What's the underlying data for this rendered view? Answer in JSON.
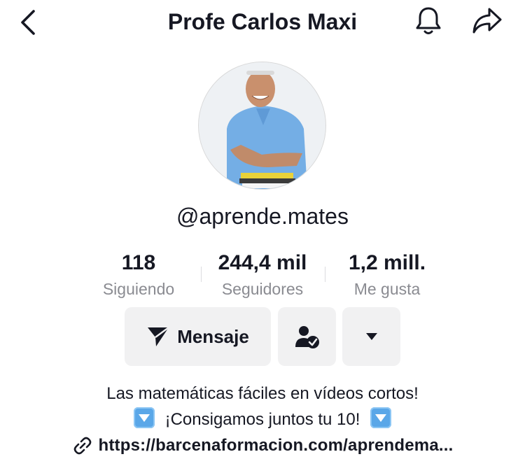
{
  "header": {
    "title": "Profe Carlos Maxi",
    "back_icon": "chevron-left-icon",
    "bell_icon": "bell-icon",
    "share_icon": "share-arrow-icon"
  },
  "profile": {
    "username": "@aprende.mates",
    "avatar_icon": "profile-photo"
  },
  "stats": [
    {
      "value": "118",
      "label": "Siguiendo"
    },
    {
      "value": "244,4 mil",
      "label": "Seguidores"
    },
    {
      "value": "1,2 mill.",
      "label": "Me gusta"
    }
  ],
  "actions": {
    "message_label": "Mensaje",
    "message_icon": "paper-plane-icon",
    "follow_icon": "person-check-icon",
    "more_icon": "caret-down-icon"
  },
  "bio": {
    "line1": "Las matemáticas fáciles en vídeos cortos!",
    "line2": "¡Consigamos juntos tu 10!",
    "emoji_icon": "down-arrow-emoji-icon",
    "link": "https://barcenaformacion.com/aprendema...",
    "link_icon": "link-icon"
  },
  "colors": {
    "text": "#161823",
    "secondary_text": "#8a8b91",
    "button_bg": "#f1f1f2",
    "emoji_blue": "#5aa7e8"
  }
}
